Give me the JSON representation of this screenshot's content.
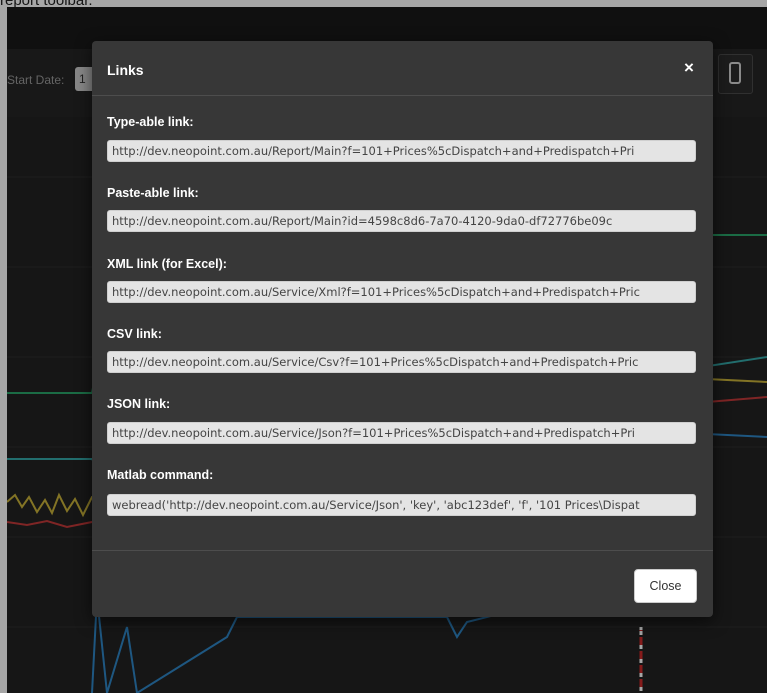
{
  "page": {
    "caption": "report toolbar."
  },
  "toolbar": {
    "start_date_label": "Start Date:",
    "start_date_value": "1"
  },
  "chart_data": {
    "type": "line",
    "title": "",
    "series_colors": [
      "#2aa66a",
      "#35a9a9",
      "#c9b23a",
      "#c43a3a",
      "#2f86c6"
    ]
  },
  "modal": {
    "title": "Links",
    "close_icon_glyph": "×",
    "fields": [
      {
        "label": "Type-able link:",
        "value": "http://dev.neopoint.com.au/Report/Main?f=101+Prices%5cDispatch+and+Predispatch+Pri"
      },
      {
        "label": "Paste-able link:",
        "value": "http://dev.neopoint.com.au/Report/Main?id=4598c8d6-7a70-4120-9da0-df72776be09c"
      },
      {
        "label": "XML link (for Excel):",
        "value": "http://dev.neopoint.com.au/Service/Xml?f=101+Prices%5cDispatch+and+Predispatch+Pric"
      },
      {
        "label": "CSV link:",
        "value": "http://dev.neopoint.com.au/Service/Csv?f=101+Prices%5cDispatch+and+Predispatch+Pric"
      },
      {
        "label": "JSON link:",
        "value": "http://dev.neopoint.com.au/Service/Json?f=101+Prices%5cDispatch+and+Predispatch+Pri"
      },
      {
        "label": "Matlab command:",
        "value": "webread('http://dev.neopoint.com.au/Service/Json', 'key', 'abc123def', 'f', '101 Prices\\Dispat"
      }
    ],
    "close_button_label": "Close"
  },
  "icons": {
    "close": "close-icon",
    "phone": "mobile-phone-icon"
  }
}
